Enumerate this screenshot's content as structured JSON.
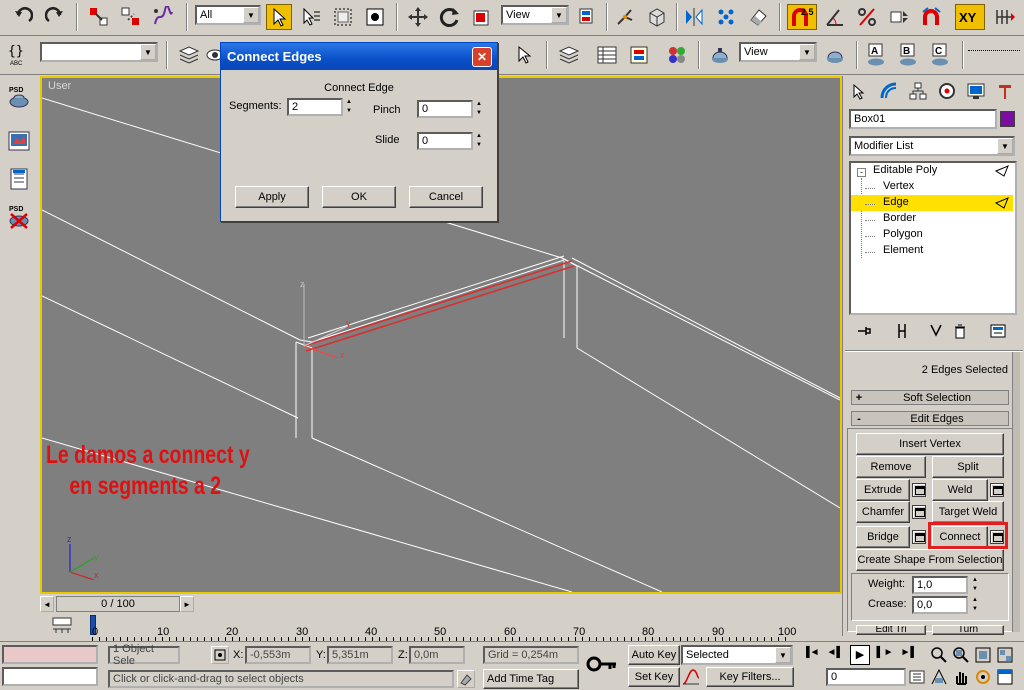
{
  "toolbar1": {
    "selection_filter": "All",
    "ref_coord": "View",
    "snap_value": "2.5",
    "axis_label": "XY"
  },
  "toolbar2": {
    "named_selection": "",
    "view_combo": "View",
    "curly_label": "{}",
    "abc_label": "ABC"
  },
  "dialog": {
    "title": "Connect Edges",
    "section": "Connect Edge",
    "segments_label": "Segments:",
    "segments_value": "2",
    "pinch_label": "Pinch",
    "pinch_value": "0",
    "slide_label": "Slide",
    "slide_value": "0",
    "apply_label": "Apply",
    "ok_label": "OK",
    "cancel_label": "Cancel",
    "close_label": "✕"
  },
  "viewport": {
    "label": "User",
    "annotation_line1": "Le damos a connect  y",
    "annotation_line2": "en segments a 2",
    "gizmo_x": "x",
    "gizmo_y": "y",
    "gizmo_z": "z"
  },
  "command_panel": {
    "object_name": "Box01",
    "object_color": "#7a0f9e",
    "modifier_list": "Modifier List",
    "stack": [
      "Editable Poly",
      "Vertex",
      "Edge",
      "Border",
      "Polygon",
      "Element"
    ],
    "selected_index": 2,
    "selection_info": "2 Edges Selected",
    "soft_selection": "Soft Selection",
    "edit_edges": "Edit Edges",
    "soft_sign": "+",
    "edit_sign": "-",
    "insert_vertex": "Insert Vertex",
    "remove": "Remove",
    "split": "Split",
    "extrude": "Extrude",
    "weld": "Weld",
    "chamfer": "Chamfer",
    "target_weld": "Target Weld",
    "bridge": "Bridge",
    "connect": "Connect",
    "create_shape": "Create Shape From Selection",
    "weight_label": "Weight:",
    "weight_value": "1,0",
    "crease_label": "Crease:",
    "crease_value": "0,0",
    "edit_tri": "Edit Tri",
    "turn": "Turn"
  },
  "timeline": {
    "frame": "0 / 100",
    "ticks": [
      "0",
      "10",
      "20",
      "30",
      "40",
      "50",
      "60",
      "70",
      "80",
      "90",
      "100"
    ],
    "prev_arrow": "◄",
    "next_arrow": "►"
  },
  "status": {
    "object_count": "1 Object Sele",
    "x_label": "X:",
    "x_value": "-0,553m",
    "y_label": "Y:",
    "y_value": "5,351m",
    "z_label": "Z:",
    "z_value": "0,0m",
    "grid": "Grid = 0,254m",
    "prompt": "Click or click-and-drag to select objects",
    "add_time_tag": "Add Time Tag",
    "auto_key": "Auto Key",
    "set_key": "Set Key",
    "key_mode": "Selected",
    "key_filters": "Key Filters...",
    "current_frame": "0"
  },
  "colors": {
    "viewport_bg": "#7f7f7f",
    "active_border": "#e8c800",
    "highlight_yellow": "#ffe000",
    "dialog_title": "#0a5fd8",
    "annotation_red": "#e01010",
    "connect_highlight": "#e02020"
  }
}
